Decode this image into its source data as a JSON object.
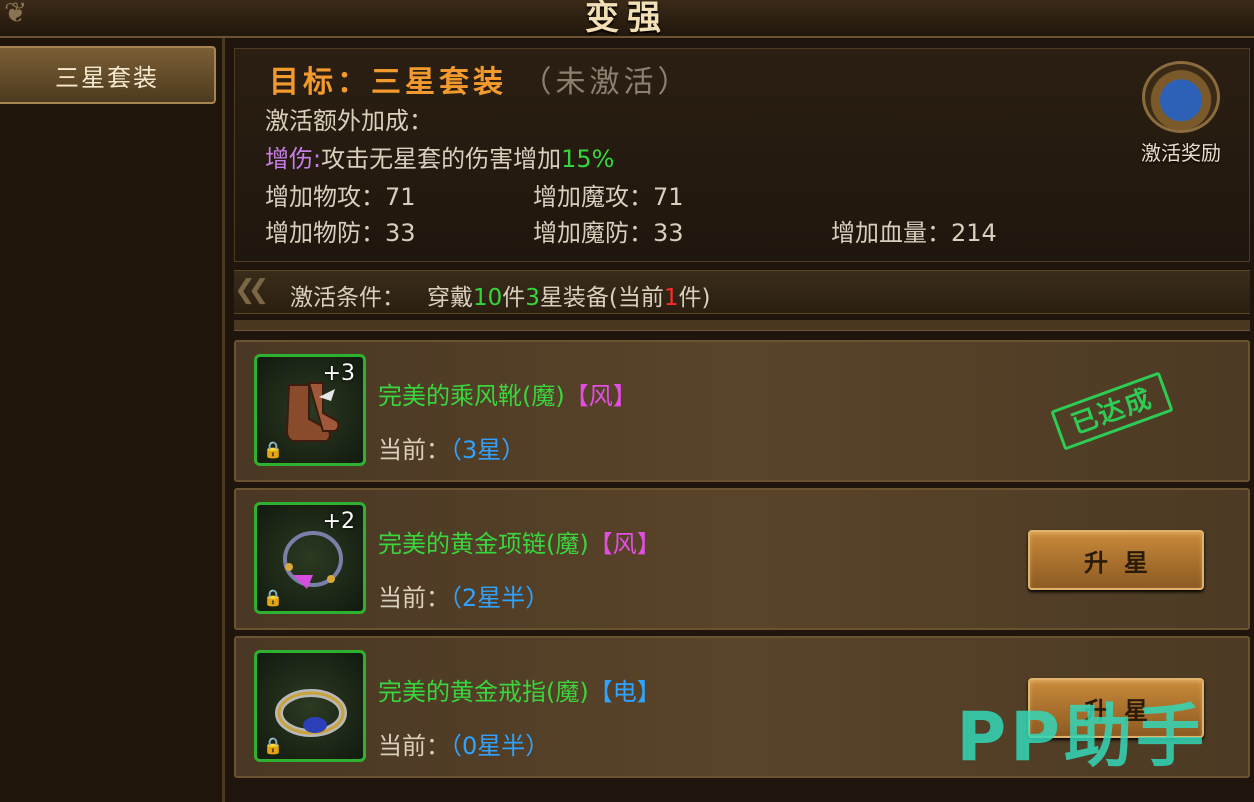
{
  "window": {
    "title": "变强"
  },
  "sidebar": {
    "tabs": [
      {
        "label": "三星套装"
      }
    ]
  },
  "header": {
    "goal_prefix": "目标：",
    "goal_name": "三星套装",
    "goal_state": "（未激活）",
    "bonus_title": "激活额外加成：",
    "special_label": "增伤:",
    "special_text": "攻击无星套的伤害增加",
    "special_value": "15%",
    "stats": [
      {
        "label": "增加物攻：",
        "value": "71"
      },
      {
        "label": "增加魔攻：",
        "value": "71"
      },
      {
        "label": "增加物防：",
        "value": "33"
      },
      {
        "label": "增加魔防：",
        "value": "33"
      },
      {
        "label": "增加血量：",
        "value": "214"
      }
    ],
    "reward_label": "激活奖励"
  },
  "condition": {
    "label": "激活条件：",
    "text_1": "穿戴",
    "count": "10",
    "text_2": "件",
    "stars": "3",
    "text_3": "星装备(当前",
    "current": "1",
    "text_4": "件)"
  },
  "items": [
    {
      "plus": "+3",
      "name": "完美的乘风靴(魔)",
      "tag": "【风】",
      "current_label": "当前：",
      "current_value": "（3星）",
      "stamp": "已达成",
      "icon": "boots-icon"
    },
    {
      "plus": "+2",
      "name": "完美的黄金项链(魔)",
      "tag": "【风】",
      "current_label": "当前：",
      "current_value": "（2星半）",
      "button": "升星",
      "icon": "necklace-icon"
    },
    {
      "plus": "",
      "name": "完美的黄金戒指(魔)",
      "tag": "【电】",
      "current_label": "当前：",
      "current_value": "（0星半）",
      "button": "升星",
      "icon": "ring-icon"
    }
  ],
  "watermark": "PP助手",
  "colors": {
    "accent_orange": "#f29a2e",
    "green": "#35d63c",
    "blue": "#2fa3ff",
    "magenta": "#e44de4",
    "red": "#ff2b2b"
  }
}
